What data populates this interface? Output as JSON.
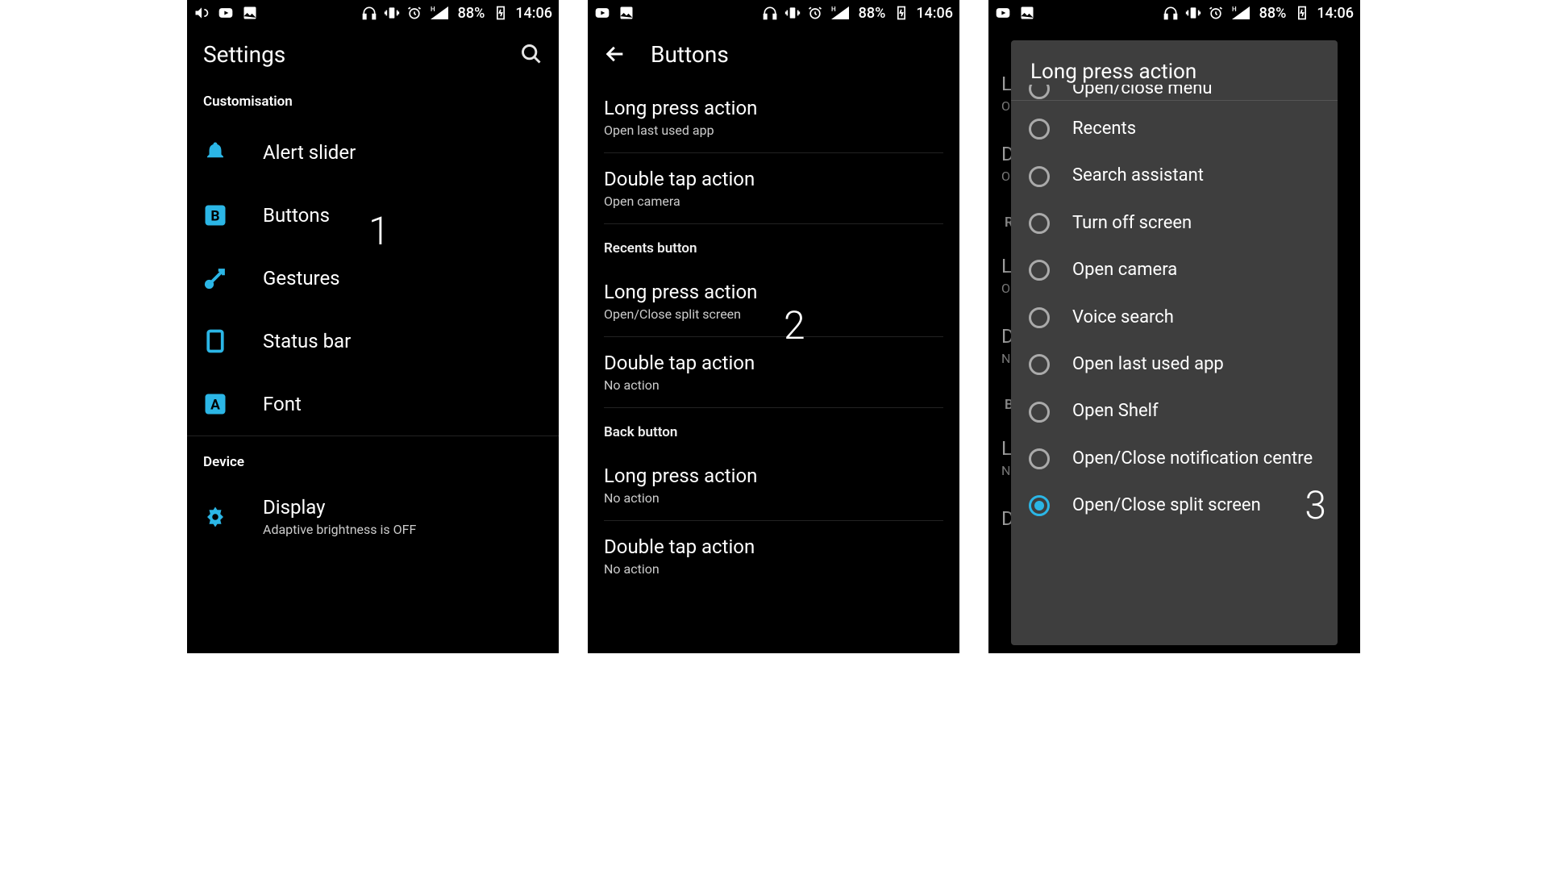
{
  "statusbar": {
    "battery_text": "88%",
    "clock": "14:06",
    "signal_label": "H+"
  },
  "screen1": {
    "title": "Settings",
    "sections": [
      {
        "label": "Customisation",
        "items": [
          {
            "icon": "bell",
            "label": "Alert slider"
          },
          {
            "icon": "b-square",
            "label": "Buttons"
          },
          {
            "icon": "swipe",
            "label": "Gestures"
          },
          {
            "icon": "rectangle",
            "label": "Status bar"
          },
          {
            "icon": "a-square",
            "label": "Font"
          }
        ]
      },
      {
        "label": "Device",
        "items": [
          {
            "icon": "brightness",
            "label": "Display",
            "sub": "Adaptive brightness is OFF"
          }
        ]
      }
    ],
    "step_marker": "1"
  },
  "screen2": {
    "title": "Buttons",
    "groups": [
      {
        "header": null,
        "rows": [
          {
            "title": "Long press action",
            "sub": "Open last used app"
          },
          {
            "title": "Double tap action",
            "sub": "Open camera"
          }
        ]
      },
      {
        "header": "Recents button",
        "rows": [
          {
            "title": "Long press action",
            "sub": "Open/Close split screen"
          },
          {
            "title": "Double tap action",
            "sub": "No action"
          }
        ]
      },
      {
        "header": "Back button",
        "rows": [
          {
            "title": "Long press action",
            "sub": "No action"
          },
          {
            "title": "Double tap action",
            "sub": "No action"
          }
        ]
      }
    ],
    "step_marker": "2"
  },
  "screen3": {
    "dialog_title": "Long press action",
    "peek_option": "Open/close menu",
    "options": [
      {
        "label": "Recents",
        "checked": false
      },
      {
        "label": "Search assistant",
        "checked": false
      },
      {
        "label": "Turn off screen",
        "checked": false
      },
      {
        "label": "Open camera",
        "checked": false
      },
      {
        "label": "Voice search",
        "checked": false
      },
      {
        "label": "Open last used app",
        "checked": false
      },
      {
        "label": "Open Shelf",
        "checked": false
      },
      {
        "label": "Open/Close notification centre",
        "checked": false
      },
      {
        "label": "Open/Close split screen",
        "checked": true
      }
    ],
    "step_marker": "3",
    "bg_rows": [
      {
        "line1": "L",
        "line2": "O"
      },
      {
        "line1": "D",
        "line2": "O"
      },
      {
        "header": "R"
      },
      {
        "line1": "L",
        "line2": "O"
      },
      {
        "line1": "D",
        "line2": "N"
      },
      {
        "header": "B"
      },
      {
        "line1": "L",
        "line2": "N"
      },
      {
        "line1": "D"
      }
    ]
  }
}
